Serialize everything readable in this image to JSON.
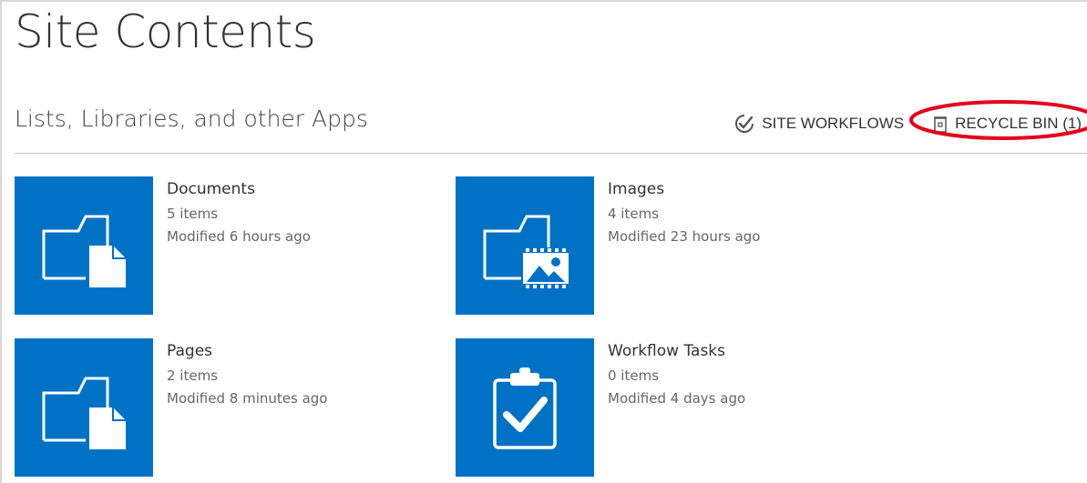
{
  "page": {
    "title": "Site Contents"
  },
  "section": {
    "title": "Lists, Libraries, and other Apps",
    "site_workflows_label": "SITE WORKFLOWS",
    "recycle_bin_label": "RECYCLE BIN (1)",
    "site_workflows_icon": "check-circle-icon",
    "recycle_bin_icon": "trash-can-icon",
    "highlight_color": "#e3001b"
  },
  "tiles": [
    {
      "name": "Documents",
      "count": "5 items",
      "modified": "Modified 6 hours ago",
      "icon": "folder-document-icon"
    },
    {
      "name": "Images",
      "count": "4 items",
      "modified": "Modified 23 hours ago",
      "icon": "folder-image-icon"
    },
    {
      "name": "Pages",
      "count": "2 items",
      "modified": "Modified 8 minutes ago",
      "icon": "folder-document-icon"
    },
    {
      "name": "Workflow Tasks",
      "count": "0 items",
      "modified": "Modified 4 days ago",
      "icon": "clipboard-check-icon"
    }
  ],
  "colors": {
    "tile_background": "#0072c6",
    "tile_icon": "#ffffff"
  }
}
